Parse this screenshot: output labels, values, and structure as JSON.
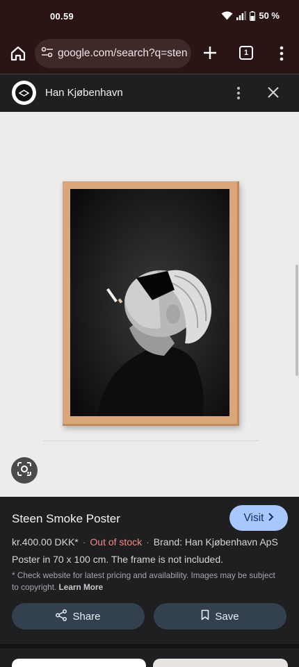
{
  "status": {
    "time": "00.59",
    "battery": "50 %"
  },
  "browser": {
    "url": "google.com/search?q=sten",
    "tab_count": "1",
    "icons": [
      "home-icon",
      "tune-icon",
      "plus-icon",
      "tabs-icon",
      "more-vert-icon"
    ]
  },
  "panel": {
    "site_name": "Han Kjøbenhavn",
    "icons": [
      "site-logo",
      "more-vert-icon",
      "close-icon"
    ]
  },
  "product": {
    "title": "Steen Smoke Poster",
    "visit_label": "Visit",
    "price": "kr.400.00 DKK*",
    "separator": "·",
    "stock": "Out of stock",
    "brand": "Brand: Han Kjøbenhavn ApS",
    "description": "Poster in 70 x 100 cm. The frame is not included.",
    "disclaimer": "* Check website for latest pricing and availability. Images may be subject to copyright.",
    "learn_more": "Learn More",
    "share_label": "Share",
    "save_label": "Save"
  },
  "colors": {
    "accent": "#a8c7fa",
    "out_of_stock": "#f28b82",
    "toolbar": "#2b1414",
    "panel_bg": "#1f1f22"
  }
}
